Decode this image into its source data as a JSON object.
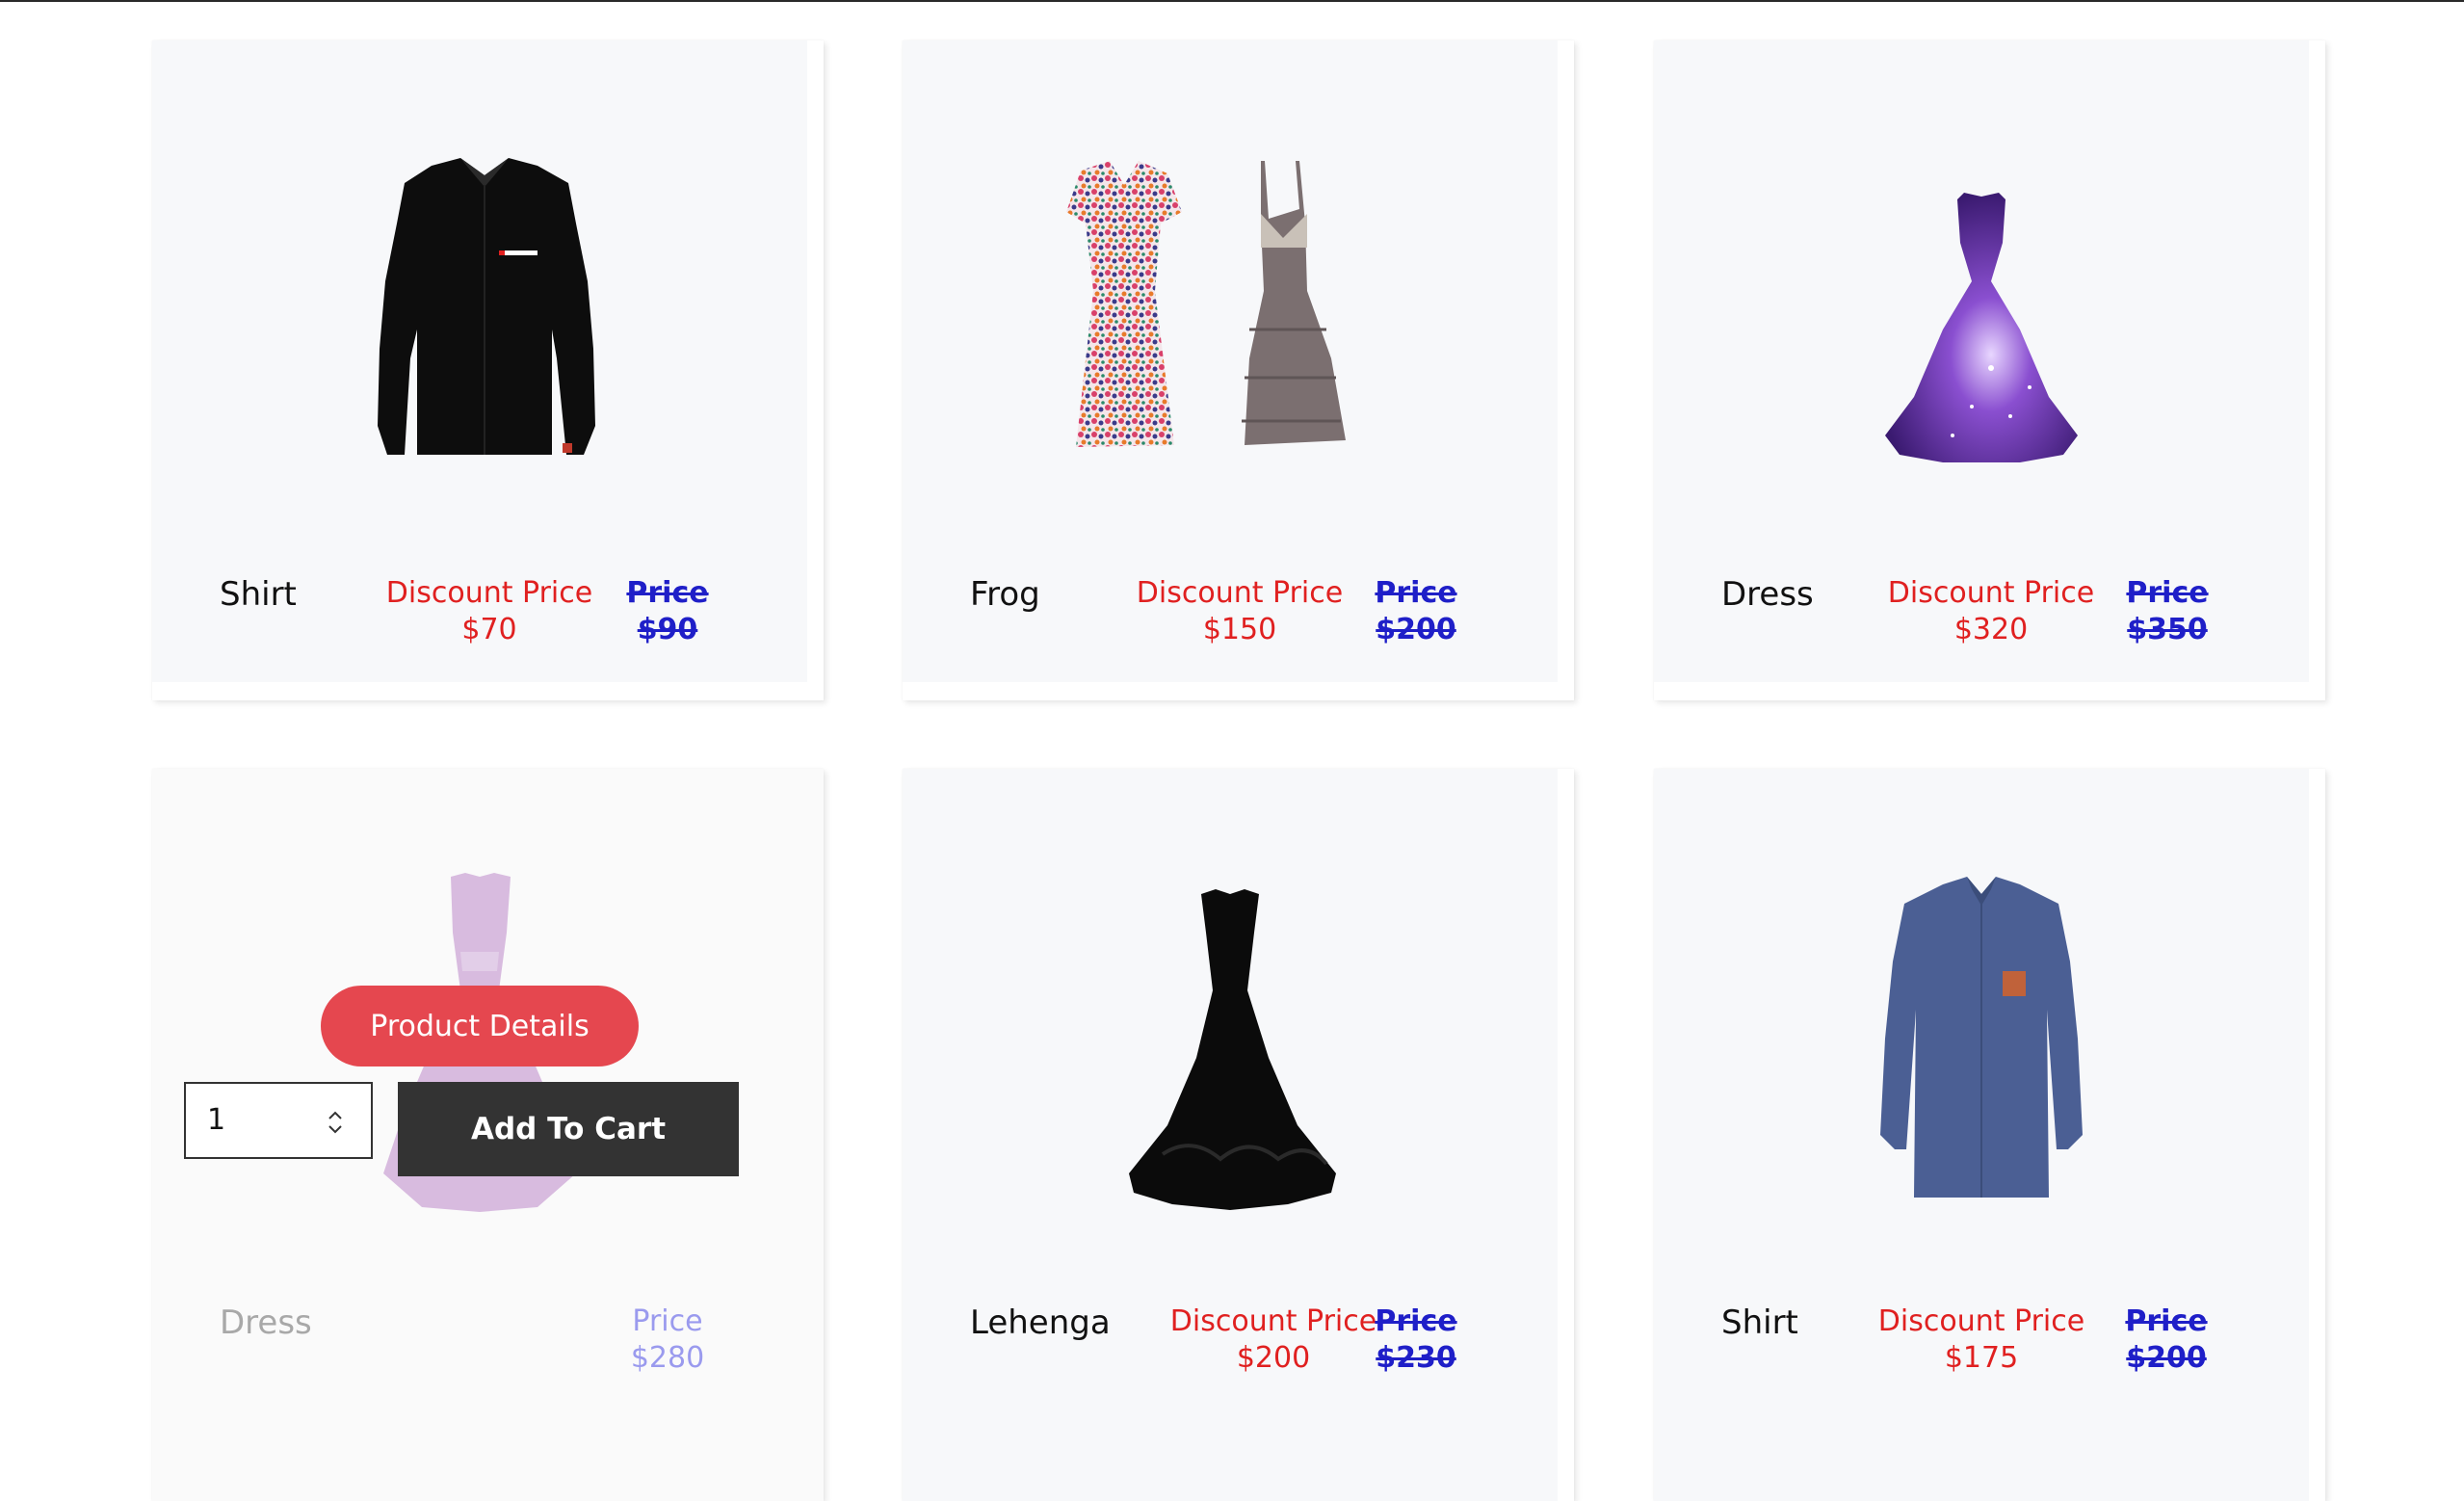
{
  "products": [
    {
      "name": "Shirt",
      "discount_label": "Discount Price",
      "discount_price": "$70",
      "price_label": "Price",
      "price": "$90",
      "image": "black-shirt"
    },
    {
      "name": "Frog",
      "discount_label": "Discount Price",
      "discount_price": "$150",
      "price_label": "Price",
      "price": "$200",
      "image": "two-dresses"
    },
    {
      "name": "Dress",
      "discount_label": "Discount Price",
      "discount_price": "$320",
      "price_label": "Price",
      "price": "$350",
      "image": "galaxy-gown"
    },
    {
      "name": "Dress",
      "discount_label": "",
      "discount_price": "",
      "price_label": "Price",
      "price": "$280",
      "image": "pink-gown",
      "hover": {
        "details_label": "Product Details",
        "quantity": "1",
        "add_to_cart_label": "Add To Cart"
      }
    },
    {
      "name": "Lehenga",
      "discount_label": "Discount Price",
      "discount_price": "$200",
      "price_label": "Price",
      "price": "$230",
      "image": "black-gown"
    },
    {
      "name": "Shirt",
      "discount_label": "Discount Price",
      "discount_price": "$175",
      "price_label": "Price",
      "price": "$200",
      "image": "blue-shirt"
    }
  ],
  "colors": {
    "discount": "#e02020",
    "price": "#1f1fc8",
    "details_button": "#e5474f",
    "cart_button": "#333333",
    "card_bg": "#f7f8fa"
  }
}
